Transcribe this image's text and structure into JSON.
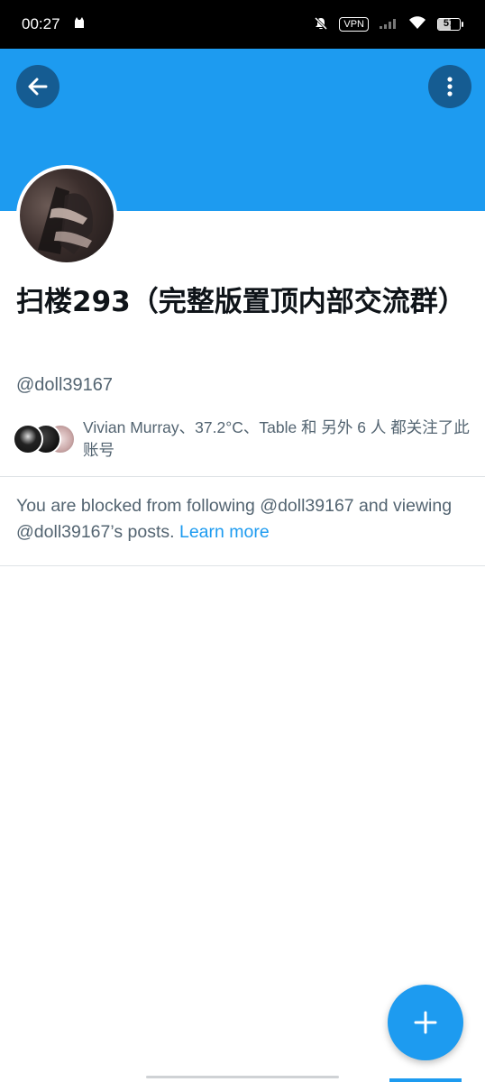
{
  "status_bar": {
    "time": "00:27",
    "vpn_label": "VPN",
    "battery_level": "57",
    "battery_fraction": 0.57
  },
  "header": {
    "back_icon": "arrow-left-icon",
    "more_icon": "more-vertical-icon",
    "banner_color": "#1d9bf0"
  },
  "profile": {
    "display_name": "扫楼293（完整版置顶内部交流群）",
    "handle": "@doll39167",
    "followers_you_know": "Vivian Murray、37.2°C、Table 和 另外 6 人 都关注了此账号"
  },
  "blocked": {
    "message": "You are blocked from following @doll39167 and viewing @doll39167’s posts. ",
    "learn_more": "Learn more"
  },
  "fab": {
    "icon": "plus-icon"
  }
}
